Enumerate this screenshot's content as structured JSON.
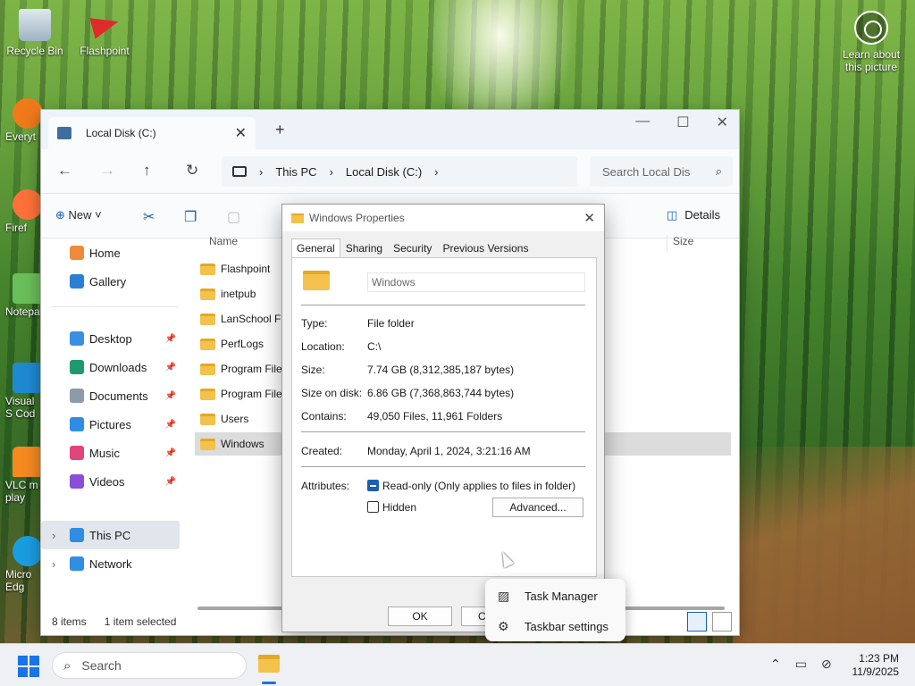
{
  "desktop": {
    "icons": [
      {
        "label": "Recycle Bin"
      },
      {
        "label": "Flashpoint"
      },
      {
        "label": "Learn about this picture"
      }
    ],
    "side_icons": [
      {
        "label": "Everyt"
      },
      {
        "label": "Firef"
      },
      {
        "label": "Notepa"
      },
      {
        "label": "Visual S Cod"
      },
      {
        "label": "VLC m play"
      },
      {
        "label": "Micro Edg"
      }
    ]
  },
  "explorer": {
    "tab_title": "Local Disk (C:)",
    "breadcrumbs": [
      "This PC",
      "Local Disk (C:)"
    ],
    "search_placeholder": "Search Local Dis",
    "toolbar": {
      "new_label": "New",
      "details_label": "Details"
    },
    "nav": {
      "home": "Home",
      "gallery": "Gallery",
      "desktop": "Desktop",
      "downloads": "Downloads",
      "documents": "Documents",
      "pictures": "Pictures",
      "music": "Music",
      "videos": "Videos",
      "this_pc": "This PC",
      "network": "Network"
    },
    "columns": {
      "name": "Name",
      "size": "Size"
    },
    "files": [
      "Flashpoint",
      "inetpub",
      "LanSchool File",
      "PerfLogs",
      "Program Files",
      "Program Files",
      "Users",
      "Windows"
    ],
    "status": {
      "count": "8 items",
      "selected": "1 item selected"
    }
  },
  "properties": {
    "title": "Windows Properties",
    "tabs": [
      "General",
      "Sharing",
      "Security",
      "Previous Versions"
    ],
    "name": "Windows",
    "type_label": "Type:",
    "type_value": "File folder",
    "location_label": "Location:",
    "location_value": "C:\\",
    "size_label": "Size:",
    "size_value": "7.74 GB (8,312,385,187 bytes)",
    "size_on_disk_label": "Size on disk:",
    "size_on_disk_value": "6.86 GB (7,368,863,744 bytes)",
    "contains_label": "Contains:",
    "contains_value": "49,050 Files, 11,961 Folders",
    "created_label": "Created:",
    "created_value": "Monday, April 1, 2024, 3:21:16 AM",
    "attributes_label": "Attributes:",
    "readonly_label": "Read-only (Only applies to files in folder)",
    "hidden_label": "Hidden",
    "advanced_label": "Advanced...",
    "ok_label": "OK",
    "cancel_label": "Cancel"
  },
  "context_menu": {
    "items": [
      "Task Manager",
      "Taskbar settings"
    ]
  },
  "taskbar": {
    "search_label": "Search",
    "time": "1:23 PM",
    "date": "11/9/2025"
  }
}
